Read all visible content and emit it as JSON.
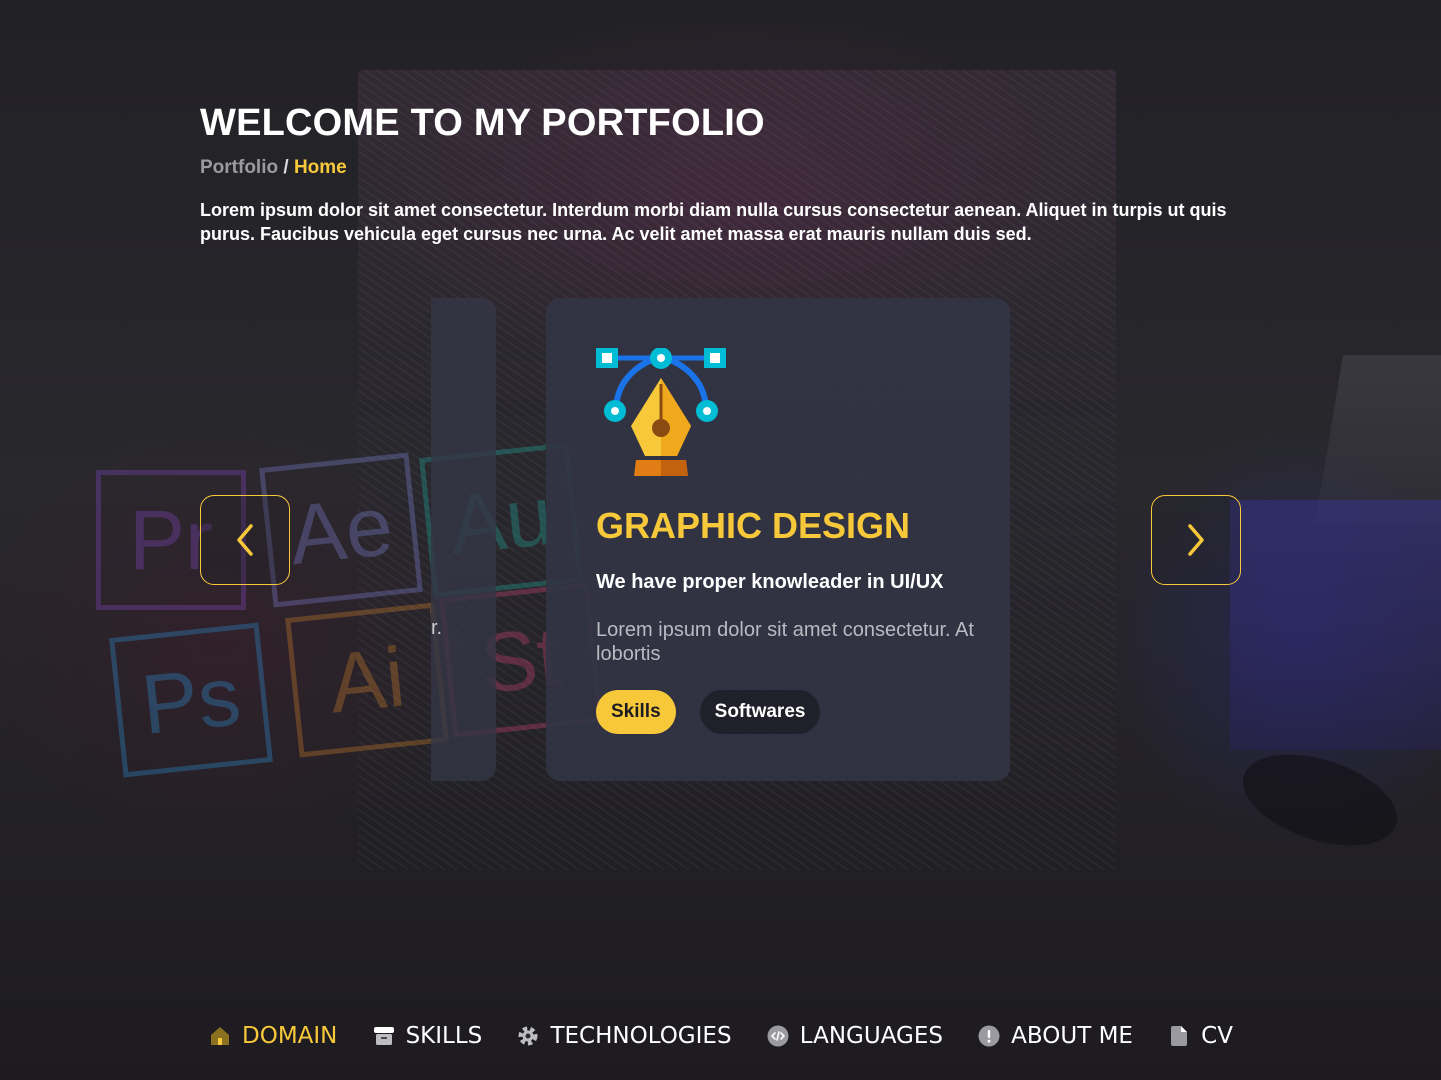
{
  "header": {
    "title": "WELCOME TO MY PORTFOLIO",
    "breadcrumb": {
      "root": "Portfolio",
      "separator": " / ",
      "current": "Home"
    },
    "intro": "Lorem ipsum dolor sit amet consectetur. Interdum morbi diam nulla cursus consectetur aenean. Aliquet in turpis ut quis purus. Faucibus vehicula eget cursus nec urna. Ac velit amet massa erat mauris nullam duis sed."
  },
  "background": {
    "tiles": [
      "Pr",
      "Ae",
      "Au",
      "Ps",
      "Ai",
      "St"
    ]
  },
  "carousel": {
    "prev_card_partial_text": "r.",
    "active_card": {
      "icon": "pen-tool-icon",
      "title": "GRAPHIC DESIGN",
      "subtitle": "We have proper knowleader in UI/UX",
      "description": "Lorem ipsum dolor sit amet consectetur. At lobortis",
      "chips": [
        {
          "label": "Skills",
          "active": true
        },
        {
          "label": "Softwares",
          "active": false
        }
      ]
    },
    "prev_icon": "chevron-left-icon",
    "next_icon": "chevron-right-icon"
  },
  "nav": {
    "items": [
      {
        "label": "DOMAIN",
        "icon": "home-icon",
        "active": true
      },
      {
        "label": "SKILLS",
        "icon": "skills-icon",
        "active": false
      },
      {
        "label": "TECHNOLOGIES",
        "icon": "gear-icon",
        "active": false
      },
      {
        "label": "LANGUAGES",
        "icon": "code-icon",
        "active": false
      },
      {
        "label": "ABOUT ME",
        "icon": "info-icon",
        "active": false
      },
      {
        "label": "CV",
        "icon": "document-icon",
        "active": false
      }
    ]
  },
  "colors": {
    "accent": "#f7c93a",
    "card": "#32344a",
    "text": "#ffffff",
    "muted": "#9a9aa0"
  }
}
